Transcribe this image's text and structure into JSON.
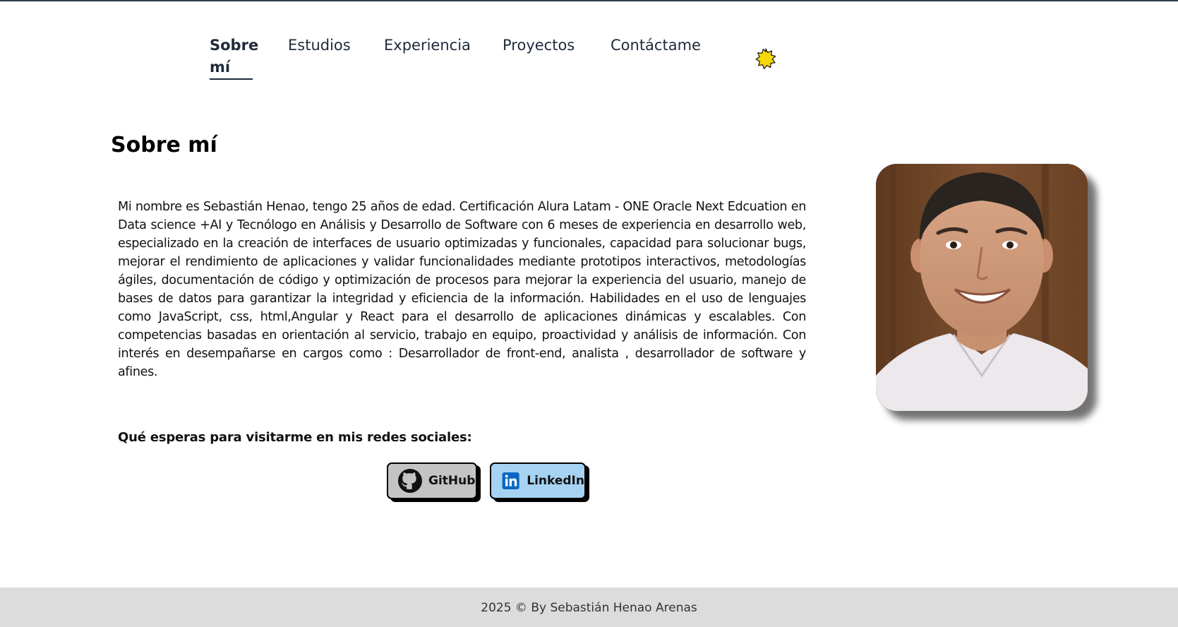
{
  "nav": {
    "items": [
      {
        "label": "Sobre mí",
        "active": true
      },
      {
        "label": "Estudios",
        "active": false
      },
      {
        "label": "Experiencia",
        "active": false
      },
      {
        "label": "Proyectos",
        "active": false
      },
      {
        "label": "Contáctame",
        "active": false
      }
    ],
    "theme_toggle_icon": "sun-icon",
    "theme_toggle_color": "#f5d90a"
  },
  "about": {
    "title": "Sobre mí",
    "bio": "Mi nombre es Sebastián Henao, tengo 25 años de edad. Certificación Alura Latam - ONE Oracle Next Edcuation en Data science +AI y Tecnólogo en Análisis y Desarrollo de Software con 6 meses de experiencia en desarrollo web, especializado en la creación de interfaces de usuario optimizadas y funcionales, capacidad para solucionar bugs, mejorar el rendimiento de aplicaciones y validar funcionalidades mediante prototipos interactivos, metodologías ágiles, documentación de código y optimización de procesos para mejorar la experiencia del usuario, manejo de bases de datos para garantizar la integridad y eficiencia de la información. Habilidades en el uso de lenguajes como JavaScript, css, html,Angular y React para el desarrollo de aplicaciones dinámicas y escalables. Con competencias basadas en orientación al servicio, trabajo en equipo, proactividad y análisis de información. Con interés en desempañarse en cargos como : Desarrollador de front-end, analista , desarrollador de software y afines.",
    "social_prompt": "Qué esperas para visitarme en mis redes sociales:",
    "social_buttons": [
      {
        "label": "GitHub",
        "icon": "github-icon",
        "color": "#c4c4c4"
      },
      {
        "label": "LinkedIn",
        "icon": "linkedin-icon",
        "color": "#a7d3f2"
      }
    ],
    "photo_icon": "profile-photo"
  },
  "footer": {
    "text": "2025 © By Sebastián Henao Arenas"
  }
}
